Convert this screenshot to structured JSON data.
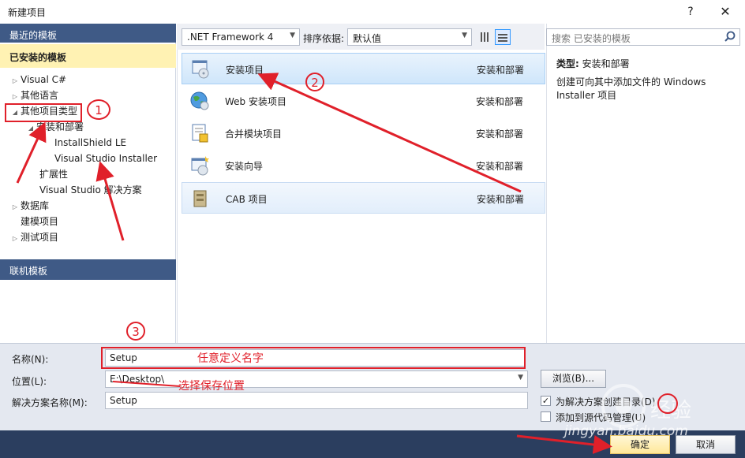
{
  "window": {
    "title": "新建项目",
    "help": "?",
    "close": "✕"
  },
  "left": {
    "recent_header": "最近的模板",
    "installed_header": "已安装的模板",
    "tree": [
      {
        "label": "Visual C#",
        "indent": 0,
        "arrow": "right"
      },
      {
        "label": "其他语言",
        "indent": 0,
        "arrow": "right"
      },
      {
        "label": "其他项目类型",
        "indent": 0,
        "arrow": "down"
      },
      {
        "label": "安装和部署",
        "indent": 1,
        "arrow": "down"
      },
      {
        "label": "InstallShield LE",
        "indent": 2,
        "arrow": ""
      },
      {
        "label": "Visual Studio Installer",
        "indent": 2,
        "arrow": ""
      },
      {
        "label": "扩展性",
        "indent": 1,
        "arrow": ""
      },
      {
        "label": "Visual Studio 解决方案",
        "indent": 1,
        "arrow": ""
      },
      {
        "label": "数据库",
        "indent": 0,
        "arrow": "right"
      },
      {
        "label": "建模项目",
        "indent": 0,
        "arrow": ""
      },
      {
        "label": "测试项目",
        "indent": 0,
        "arrow": "right"
      }
    ],
    "online_header": "联机模板"
  },
  "toolbar": {
    "framework": ".NET Framework 4",
    "sort_label": "排序依据:",
    "sort_value": "默认值"
  },
  "templates": [
    {
      "name": "安装项目",
      "category": "安装和部署",
      "icon": "setup-project-icon"
    },
    {
      "name": "Web 安装项目",
      "category": "安装和部署",
      "icon": "web-setup-icon"
    },
    {
      "name": "合并模块项目",
      "category": "安装和部署",
      "icon": "merge-module-icon"
    },
    {
      "name": "安装向导",
      "category": "安装和部署",
      "icon": "setup-wizard-icon"
    },
    {
      "name": "CAB 项目",
      "category": "安装和部署",
      "icon": "cab-project-icon"
    }
  ],
  "right": {
    "search_placeholder": "搜索 已安装的模板",
    "type_label": "类型:",
    "type_value": "安装和部署",
    "description": "创建可向其中添加文件的 Windows Installer 项目"
  },
  "form": {
    "name_label": "名称(N):",
    "name_value": "Setup",
    "location_label": "位置(L):",
    "location_value": "E:\\Desktop\\",
    "solution_label": "解决方案名称(M):",
    "solution_value": "Setup",
    "browse": "浏览(B)...",
    "chk1_label": "为解决方案创建目录(D)",
    "chk1_checked": "✓",
    "chk2_label": "添加到源代码管理(U)"
  },
  "buttons": {
    "ok": "确定",
    "cancel": "取消"
  },
  "annotations": {
    "c1": "1",
    "c2": "2",
    "c3": "3",
    "name_hint": "任意定义名字",
    "location_hint": "选择保存位置"
  },
  "watermark": {
    "brand": "经验",
    "url": "jingyan.baidu.com"
  },
  "colors": {
    "accent": "#3f5a86",
    "annotation": "#e0202a",
    "selection": "#cfe6fb"
  }
}
